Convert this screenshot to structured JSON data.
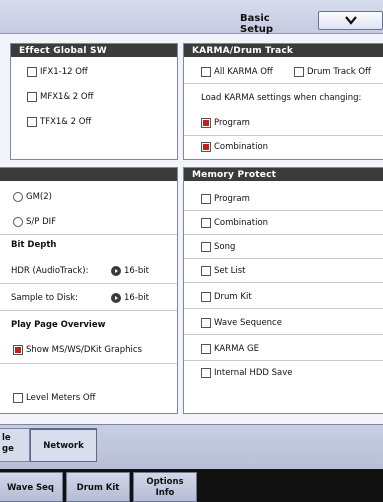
{
  "header": {
    "title": "Basic Setup"
  },
  "effect_global": {
    "title": "Effect Global SW",
    "items": [
      {
        "label": "IFX1-12 Off",
        "checked": false
      },
      {
        "label": "MFX1& 2 Off",
        "checked": false
      },
      {
        "label": "TFX1& 2 Off",
        "checked": false
      }
    ]
  },
  "karma": {
    "title": "KARMA/Drum Track",
    "all_karma_off": "All KARMA Off",
    "drum_track_off": "Drum Track Off",
    "load_label": "Load KARMA settings when changing:",
    "program": "Program",
    "combination": "Combination"
  },
  "left_lower": {
    "gm2": "GM(2)",
    "spdif": "S/P DIF",
    "bit_depth_heading": "Bit Depth",
    "hdr_label": "HDR (AudioTrack):",
    "hdr_value": "16-bit",
    "sample_label": "Sample to Disk:",
    "sample_value": "16-bit",
    "play_page_heading": "Play Page Overview",
    "show_graphics": "Show MS/WS/DKit Graphics",
    "level_meters": "Level Meters Off"
  },
  "memory_protect": {
    "title": "Memory Protect",
    "items": [
      "Program",
      "Combination",
      "Song",
      "Set List",
      "Drum Kit",
      "Wave Sequence",
      "KARMA GE",
      "Internal HDD Save"
    ]
  },
  "tabs": {
    "partial_line1": "le",
    "partial_line2": "ge",
    "network": "Network"
  },
  "bottom_tabs": {
    "wave_seq": "Wave Seq",
    "drum_kit": "Drum Kit",
    "options_line1": "Options",
    "options_line2": "Info"
  }
}
